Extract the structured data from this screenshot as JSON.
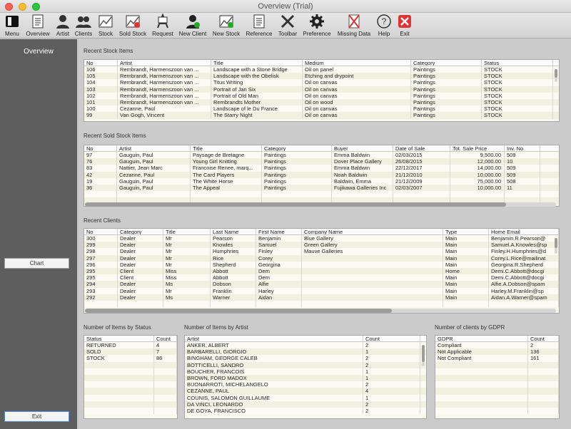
{
  "window": {
    "title": "Overview (Trial)"
  },
  "toolbar": [
    "Menu",
    "Overview",
    "Artist",
    "Clients",
    "Stock",
    "Sold Stock",
    "Request",
    "New Client",
    "New Stock",
    "Reference",
    "Toolbar",
    "Preference",
    "Missing Data",
    "Help",
    "Exit"
  ],
  "toolbar_icons": [
    "menu-icon",
    "document-icon",
    "artist-icon",
    "clients-icon",
    "stock-chart-icon",
    "sold-stock-chart-icon",
    "request-easel-icon",
    "new-client-icon",
    "new-stock-icon",
    "reference-icon",
    "toolbar-tools-icon",
    "gear-icon",
    "missing-data-icon",
    "help-icon",
    "exit-icon"
  ],
  "sidebar": {
    "title": "Overview",
    "chart_button": "Chart",
    "exit_button": "Exit"
  },
  "recent_stock": {
    "title": "Recent Stock Items",
    "headers": [
      "No",
      "Artist",
      "Title",
      "Medium",
      "Category",
      "Status"
    ],
    "rows": [
      [
        "106",
        "Rembrandt, Harmenszoon van ...",
        "Landscape with a Stone Bridge",
        "Oil on panel",
        "Paintings",
        "STOCK"
      ],
      [
        "105",
        "Rembrandt, Harmenszoon van ...",
        "Landscape with the Obelisk",
        "Etching and drypoint",
        "Paintings",
        "STOCK"
      ],
      [
        "104",
        "Rembrandt, Harmenszoon van ...",
        "Titus Writing",
        "Oil on canvas",
        "Paintings",
        "STOCK"
      ],
      [
        "103",
        "Rembrandt, Harmenszoon van ...",
        "Portrait of Jan Six",
        "Oil on canvas",
        "Paintings",
        "STOCK"
      ],
      [
        "102",
        "Rembrandt, Harmenszoon van ...",
        "Portrait of Old Man",
        "Oil on canvas",
        "Paintings",
        "STOCK"
      ],
      [
        "101",
        "Rembrandt, Harmenszoon van ...",
        "Rembrandts Mother",
        "Oil on wood",
        "Paintings",
        "STOCK"
      ],
      [
        "100",
        "Cezanne, Paul",
        "Landscape of le Du France",
        "Oil on canvas",
        "Paintings",
        "STOCK"
      ],
      [
        "99",
        "Van Gogh, Vincent",
        "The Starry Night",
        "Oil on canvas",
        "Paintings",
        "STOCK"
      ]
    ]
  },
  "recent_sold": {
    "title": "Recent Sold Stock Items",
    "headers": [
      "No",
      "Artist",
      "Title",
      "Category",
      "Buyer",
      "Date of Sale",
      "Tot. Sale Price",
      "Inv. No"
    ],
    "rows": [
      [
        "97",
        "Gauguin, Paul",
        "Paysage de Bretagne",
        "Paintings",
        "Emma Baldwin",
        "02/03/2015",
        "9,500.00",
        "509"
      ],
      [
        "76",
        "Gauguin, Paul",
        "Young Girl Knitting",
        "Paintings",
        "Dover Place Gallery",
        "26/08/2015",
        "12,000.00",
        "10"
      ],
      [
        "83",
        "Nattier, Jean Marc",
        "Francoise Renee, marq...",
        "Paintings",
        "Emma Baldwin",
        "22/12/2017",
        "14,000.00",
        "509"
      ],
      [
        "42",
        "Cezanne, Paul",
        "The Card Players",
        "Paintings",
        "Noah Baldwin",
        "21/12/2010",
        "10,000.00",
        "509"
      ],
      [
        "19",
        "Gauguin, Paul",
        "The White Horse",
        "Paintings",
        "Baldwin, Emma",
        "21/12/2009",
        "75,000.00",
        "508"
      ],
      [
        "36",
        "Gauguin, Paul",
        "The Appeal",
        "Paintings",
        "Fujikawa Galleries Inc",
        "02/03/2007",
        "10,000.00",
        "11"
      ]
    ]
  },
  "recent_clients": {
    "title": "Recent Clients",
    "headers": [
      "No",
      "Category",
      "Title",
      "Last Name",
      "First Name",
      "Company Name",
      "Type",
      "Home Email"
    ],
    "rows": [
      [
        "300",
        "Dealer",
        "Mr",
        "Pearson",
        "Benjamin",
        "Blue Gallery",
        "Main",
        "Benjamin.R.Pearson@"
      ],
      [
        "299",
        "Dealer",
        "Mr",
        "Knowles",
        "Samuel",
        "Green Gallery",
        "Main",
        "Samuel.A.Knowles@sp"
      ],
      [
        "298",
        "Dealer",
        "Mr",
        "Humphries",
        "Finley",
        "Mauve Galleries",
        "Main",
        "Finley.H.Humphries@d"
      ],
      [
        "297",
        "Dealer",
        "Mr",
        "Rice",
        "Corey",
        "",
        "Main",
        "Corey.L.Rice@mailinat"
      ],
      [
        "296",
        "Dealer",
        "Mr",
        "Shepherd",
        "Georgina",
        "",
        "Main",
        "Georgina.R.Shepherd"
      ],
      [
        "295",
        "Client",
        "Miss",
        "Abbott",
        "Dem",
        "",
        "Home",
        "Demi.C.Abbott@docgi"
      ],
      [
        "295",
        "Client",
        "Miss",
        "Abbott",
        "Dem",
        "",
        "Main",
        "Demi.C.Abbott@docgi"
      ],
      [
        "294",
        "Dealer",
        "Ms",
        "Dobson",
        "Alfie",
        "",
        "Main",
        "Alfie.A.Dobson@spam"
      ],
      [
        "293",
        "Dealer",
        "Mr",
        "Franklin",
        "Harley",
        "",
        "Main",
        "Harley.M.Franklin@sp"
      ],
      [
        "292",
        "Dealer",
        "Ms",
        "Warner",
        "Aidan",
        "",
        "Main",
        "Aidan.A.Warner@spam"
      ]
    ]
  },
  "by_status": {
    "title": "Number of Items by Status",
    "headers": [
      "Status",
      "Count"
    ],
    "rows": [
      [
        "RETURNED",
        "4"
      ],
      [
        "SOLD",
        "7"
      ],
      [
        "STOCK",
        "86"
      ]
    ]
  },
  "by_artist": {
    "title": "Number of Items by Artist",
    "headers": [
      "Artist",
      "Count"
    ],
    "rows": [
      [
        "ANKER, ALBERT",
        "2"
      ],
      [
        "BARBARELLI, GIORGIO",
        "1"
      ],
      [
        "BINGHAM, GEORGE CALEB",
        "2"
      ],
      [
        "BOTTICELLI, SANDRO",
        "2"
      ],
      [
        "BOUCHER, FRANCOIS",
        "1"
      ],
      [
        "BROWN, FORD MADOX",
        "1"
      ],
      [
        "BUONARROTI, MICHELANGELO",
        "2"
      ],
      [
        "CEZANNE, PAUL",
        "4"
      ],
      [
        "COUNIS, SALOMON GUILLAUME",
        "1"
      ],
      [
        "DA VINCI, LEONARDO",
        "2"
      ],
      [
        "DE GOYA, FRANCISCO",
        "2"
      ]
    ]
  },
  "by_gdpr": {
    "title": "Number of clients by GDPR",
    "headers": [
      "GDPR",
      "Count"
    ],
    "rows": [
      [
        "Compliant",
        "2"
      ],
      [
        "Not Applicable",
        "136"
      ],
      [
        "Not Compliant",
        "161"
      ]
    ]
  }
}
